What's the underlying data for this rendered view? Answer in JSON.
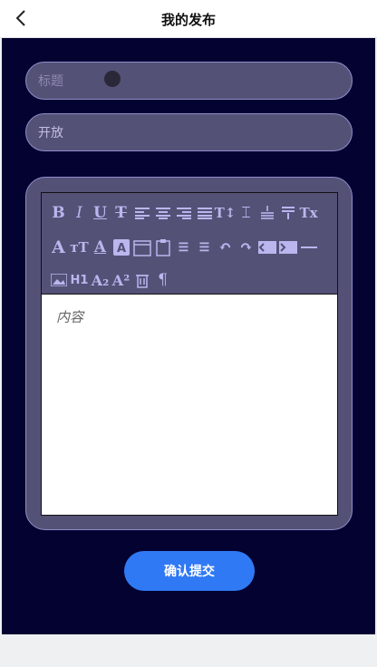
{
  "header": {
    "title": "我的发布"
  },
  "form": {
    "title_placeholder": "标题",
    "visibility_value": "开放",
    "content_placeholder": "内容",
    "submit_label": "确认提交"
  },
  "colors": {
    "page_bg": "#030231",
    "field_bg": "#545177",
    "field_border": "#8f8cc8",
    "toolbar_icon": "#bab6ee",
    "submit_bg": "#3079f4"
  },
  "toolbar": {
    "row1": [
      "bold-icon",
      "italic-icon",
      "underline-icon",
      "strikethrough-icon",
      "align-left-icon",
      "align-center-icon",
      "align-right-icon",
      "justify-icon",
      "line-height-icon",
      "text-height-icon",
      "paragraph-spacing-icon",
      "indent-down-icon",
      "clear-format-icon"
    ],
    "row2": [
      "font-family-icon",
      "font-size-icon",
      "font-color-icon",
      "background-color-icon",
      "insert-date-icon",
      "clipboard-icon",
      "ordered-list-icon",
      "unordered-list-icon",
      "undo-icon",
      "redo-icon",
      "outdent-icon",
      "indent-icon",
      "horizontal-rule-icon"
    ],
    "row3": [
      "image-icon",
      "heading-icon",
      "subscript-icon",
      "superscript-icon",
      "delete-icon",
      "paragraph-mark-icon"
    ],
    "heading_text": "H1"
  }
}
